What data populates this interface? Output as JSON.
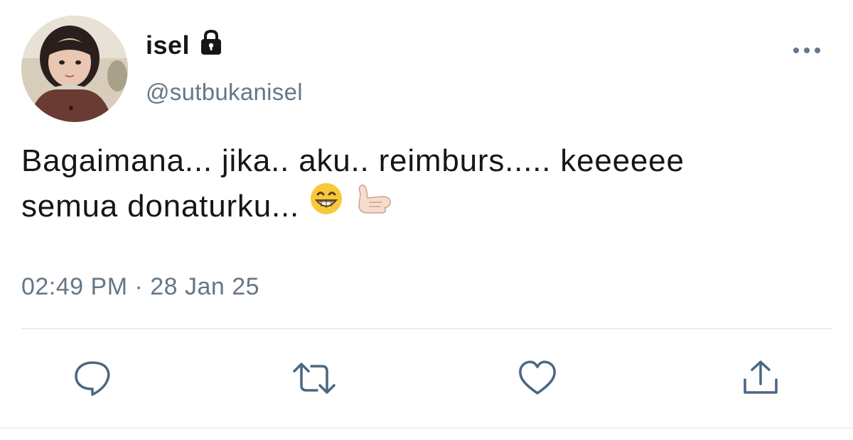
{
  "user": {
    "display_name": "isel",
    "handle": "@sutbukanisel",
    "protected_icon": "lock-icon",
    "avatar": "avatar-photo"
  },
  "tweet": {
    "lines": [
      "Bagaimana... jika.. aku.. reimburs..... keeeeee",
      "semua donaturku..."
    ],
    "emojis": [
      "grinning-face-emoji",
      "call-me-hand-emoji"
    ],
    "timestamp": "02:49 PM · 28 Jan 25"
  },
  "actions": [
    {
      "icon": "reply-icon"
    },
    {
      "icon": "retweet-icon"
    },
    {
      "icon": "like-icon"
    },
    {
      "icon": "share-icon"
    }
  ],
  "menu": {
    "icon": "more-options-icon"
  },
  "colors": {
    "text": "#14171a",
    "secondary": "#657786",
    "divider": "#e6ecf0"
  }
}
